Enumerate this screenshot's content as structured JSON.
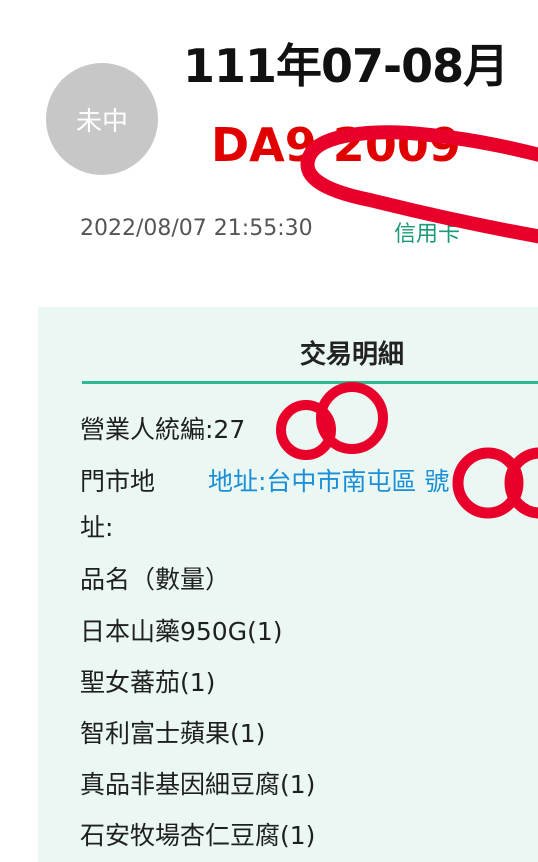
{
  "header": {
    "avatar_text": "未中",
    "period": "111年07-08月",
    "invoice_no": "DA9    2009",
    "datetime": "2022/08/07 21:55:30",
    "payment": "信用卡"
  },
  "detail": {
    "title": "交易明細",
    "tax_id": "營業人統編:27",
    "store_label": "門市地址:",
    "store_address": "地址:台中市南屯區 號",
    "items_header": "品名（數量）",
    "items": [
      "日本山藥950G(1)",
      "聖女蕃茄(1)",
      "智利富士蘋果(1)",
      "真品非基因細豆腐(1)",
      "石安牧場杏仁豆腐(1)"
    ]
  },
  "colors": {
    "invoice_red": "#e00000",
    "accent_green": "#1a9a7a",
    "panel_bg": "#eaf7f2",
    "divider": "#2fb991",
    "link_blue": "#1a8fd8",
    "avatar_gray": "#c7c7c7",
    "redaction_red": "#e8002a"
  }
}
